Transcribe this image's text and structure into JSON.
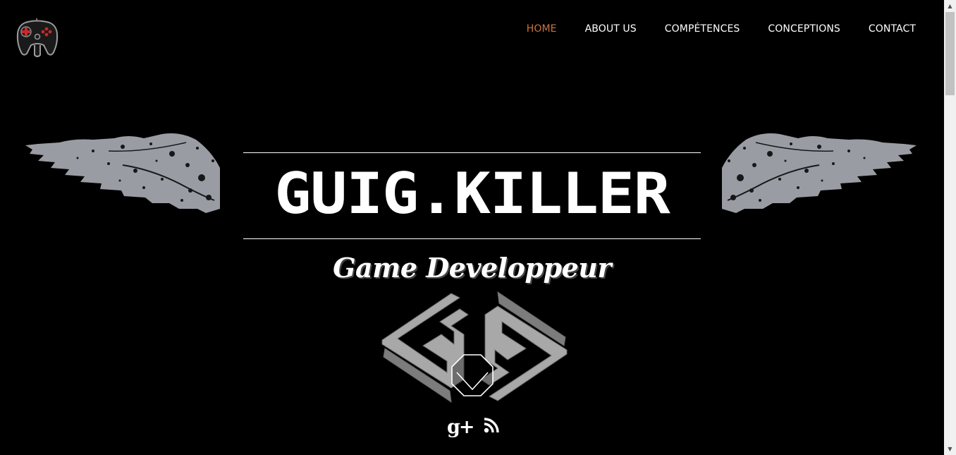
{
  "nav": {
    "items": [
      {
        "label": "HOME",
        "active": true
      },
      {
        "label": "ABOUT US",
        "active": false
      },
      {
        "label": "COMPÉTENCES",
        "active": false
      },
      {
        "label": "CONCEPTIONS",
        "active": false
      },
      {
        "label": "CONTACT",
        "active": false
      }
    ]
  },
  "hero": {
    "title": "GUIG.KILLER",
    "subtitle": "Game Developpeur"
  },
  "social": {
    "gplus_label": "g+",
    "rss_icon": "rss-icon"
  },
  "colors": {
    "background": "#000000",
    "accent": "#c9753d",
    "text": "#ffffff",
    "wing": "#9a9ca3"
  },
  "icons": {
    "logo": "gamepad-icon",
    "scroll": "chevron-down-icon",
    "gplus": "google-plus-icon",
    "rss": "rss-icon"
  }
}
